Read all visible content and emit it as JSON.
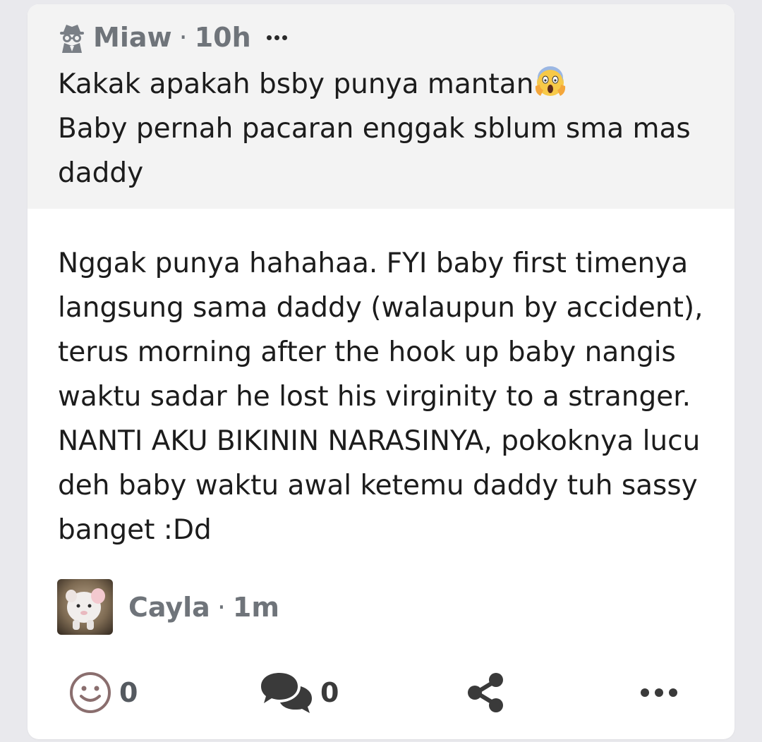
{
  "question": {
    "asker_name": "Miaw",
    "separator": "·",
    "time": "10h",
    "line1": "Kakak apakah bsby punya mantan",
    "line2": "Baby pernah pacaran enggak sblum sma mas daddy"
  },
  "answer": {
    "text": "Nggak punya hahahaa. FYI baby first timenya langsung sama daddy (walaupun by accident), terus morning after the hook up baby nangis waktu sadar he lost his virginity to a stranger. NANTI AKU BIKININ NARASINYA, pokoknya lucu deh baby waktu awal ketemu daddy tuh sassy banget :Dd"
  },
  "author": {
    "name": "Cayla",
    "separator": "·",
    "time": "1m"
  },
  "actions": {
    "reactions_count": "0",
    "comments_count": "0"
  },
  "icons": {
    "asker": "incognito-spy-icon",
    "emoji": "face-screaming-in-fear-emoji",
    "reaction": "smiley-face-icon",
    "comments": "speech-bubbles-icon",
    "share": "share-icon",
    "more": "more-dots-icon"
  },
  "colors": {
    "background": "#e9e9ed",
    "card": "#ffffff",
    "question_bg": "#f3f3f3",
    "text": "#1c1c1c",
    "meta": "#6f747a",
    "icon_brown": "#8a6e6e",
    "icon_dark": "#3a3a3a"
  }
}
